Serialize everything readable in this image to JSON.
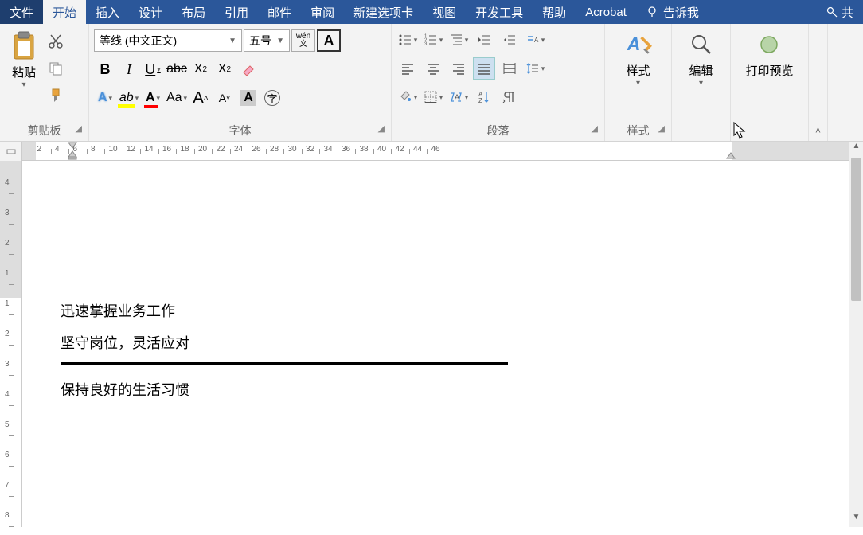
{
  "menu": {
    "file": "文件",
    "home": "开始",
    "insert": "插入",
    "design": "设计",
    "layout": "布局",
    "references": "引用",
    "mailings": "邮件",
    "review": "审阅",
    "newtab": "新建选项卡",
    "view": "视图",
    "devtools": "开发工具",
    "help": "帮助",
    "acrobat": "Acrobat",
    "tellme": "告诉我",
    "share": "共"
  },
  "ribbon": {
    "clipboard": {
      "label": "剪贴板",
      "paste": "粘贴"
    },
    "font": {
      "label": "字体",
      "name": "等线 (中文正文)",
      "size": "五号",
      "wen_top": "wén",
      "wen_bottom": "文",
      "a_box": "A"
    },
    "paragraph": {
      "label": "段落"
    },
    "styles": {
      "label": "样式",
      "btn": "样式"
    },
    "edit": {
      "label": "编辑"
    },
    "preview": {
      "label": "打印预览"
    }
  },
  "document": {
    "line1": "迅速掌握业务工作",
    "line2": "坚守岗位，灵活应对",
    "line3": "保持良好的生活习惯"
  },
  "ruler": {
    "h_ticks": [
      2,
      4,
      6,
      8,
      10,
      12,
      14,
      16,
      18,
      20,
      22,
      24,
      26,
      28,
      30,
      32,
      34,
      36,
      38,
      40,
      42,
      44,
      46
    ],
    "v_ticks": [
      4,
      3,
      2,
      1,
      1,
      2,
      3,
      4,
      5,
      6,
      7,
      8
    ]
  }
}
